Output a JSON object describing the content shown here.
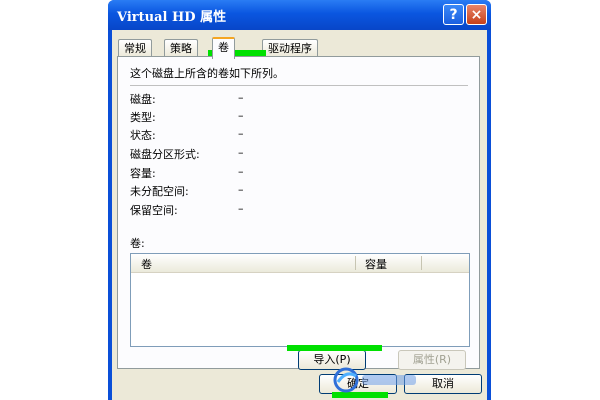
{
  "window": {
    "title": "Virtual HD 属性",
    "help_label": "?",
    "close_label": "×"
  },
  "tabs": [
    {
      "label": "常规"
    },
    {
      "label": "策略"
    },
    {
      "label": "卷",
      "active": true
    },
    {
      "label": "驱动程序"
    }
  ],
  "volume_tab": {
    "intro": "这个磁盘上所含的卷如下所列。",
    "properties": [
      {
        "label": "磁盘:",
        "value": "–"
      },
      {
        "label": "类型:",
        "value": "–"
      },
      {
        "label": "状态:",
        "value": "–"
      },
      {
        "label": "磁盘分区形式:",
        "value": "–"
      },
      {
        "label": "容量:",
        "value": "–"
      },
      {
        "label": "未分配空间:",
        "value": "–"
      },
      {
        "label": "保留空间:",
        "value": "–"
      }
    ],
    "volumes_label": "卷:",
    "columns": [
      "卷",
      "容量"
    ],
    "import_button": "导入(P)",
    "properties_button": "属性(R)"
  },
  "footer": {
    "ok_button": "确定",
    "cancel_button": "取消"
  },
  "colors": {
    "titlebar": "#0a56e0",
    "client_bg": "#ece9d8",
    "highlight": "#00e000",
    "active_tab_accent": "#f5a623"
  }
}
